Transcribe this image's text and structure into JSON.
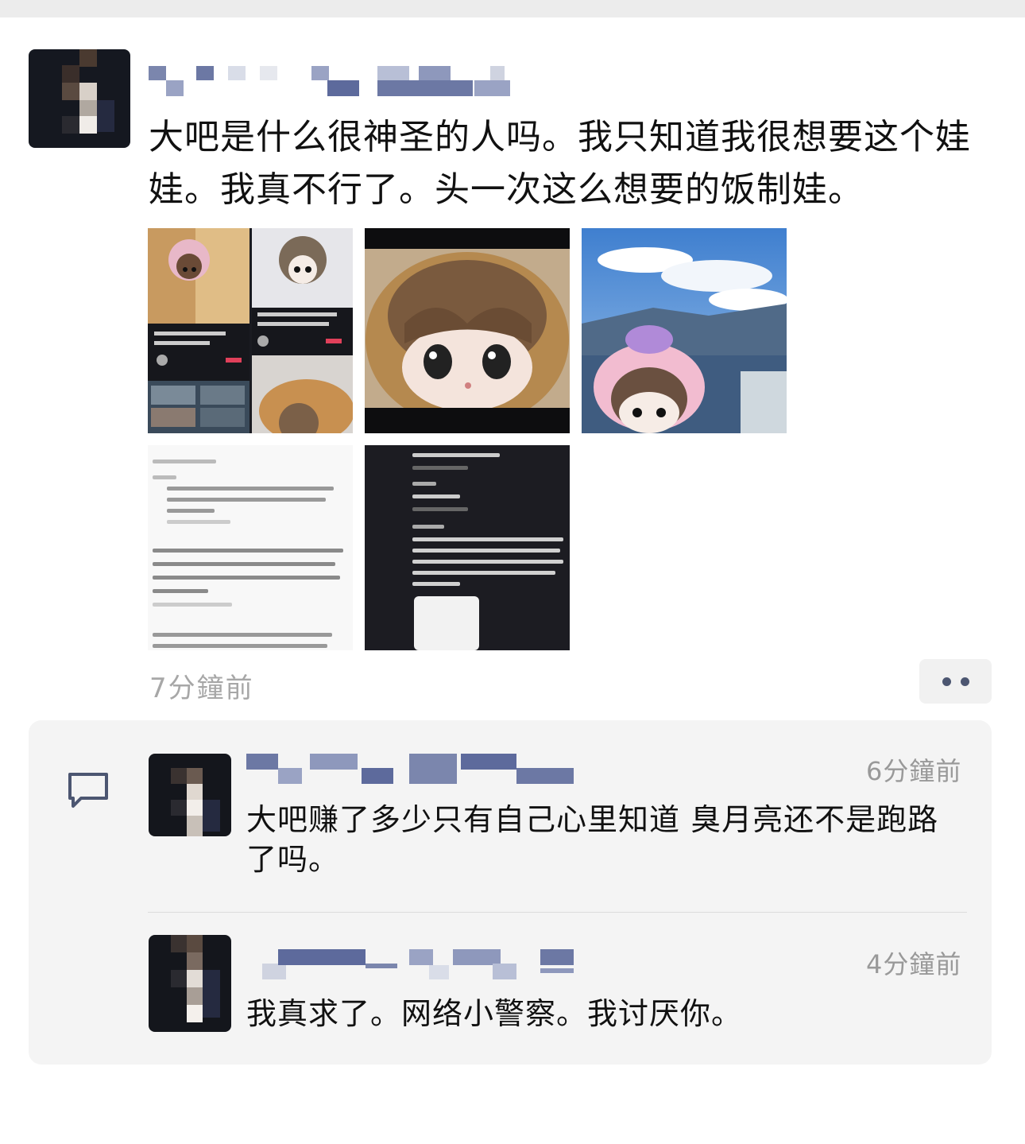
{
  "post": {
    "text": "大吧是什么很神圣的人吗。我只知道我很想要这个娃娃。我真不行了。头一次这么想要的饭制娃。",
    "time": "7分鐘前",
    "images": [
      {
        "icon": "collage-screenshot"
      },
      {
        "icon": "doll-face-closeup"
      },
      {
        "icon": "doll-with-sky"
      },
      {
        "icon": "comment-screenshot-light"
      },
      {
        "icon": "comment-screenshot-dark"
      }
    ]
  },
  "comments": [
    {
      "text": "大吧赚了多少只有自己心里知道 臭月亮还不是跑路了吗。",
      "time": "6分鐘前"
    },
    {
      "text": "我真求了。网络小警察。我讨厌你。",
      "time": "4分鐘前"
    }
  ],
  "icons": {
    "more": "more-dots-icon",
    "comment": "comment-icon"
  },
  "colors": {
    "accent": "#4c5671",
    "time": "#a7a7a7",
    "commentBg": "#f4f4f4"
  }
}
